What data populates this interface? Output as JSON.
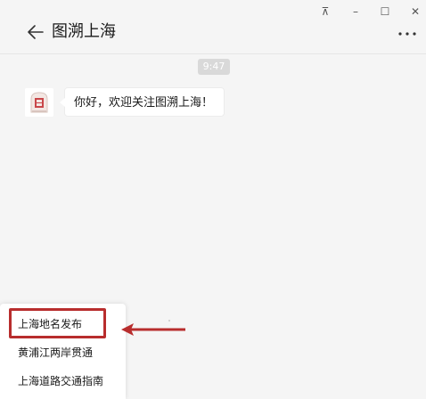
{
  "window": {
    "pin_glyph": "⊼",
    "minimize_glyph": "–",
    "maximize_glyph": "☐",
    "close_glyph": "✕"
  },
  "header": {
    "title": "图溯上海",
    "back_icon": "arrow-left-icon",
    "more_icon": "more-dots-icon"
  },
  "chat": {
    "timestamp": "9:47",
    "messages": [
      {
        "sender": "图溯上海",
        "text": "你好，欢迎关注图溯上海！"
      }
    ]
  },
  "menu": {
    "items": [
      {
        "label": "上海地名发布"
      },
      {
        "label": "黄浦江两岸贯通"
      },
      {
        "label": "上海道路交通指南"
      }
    ]
  },
  "colors": {
    "annotation_red": "#b82d2d",
    "background": "#f5f5f5",
    "timestamp_bg": "#d9d9d9"
  }
}
